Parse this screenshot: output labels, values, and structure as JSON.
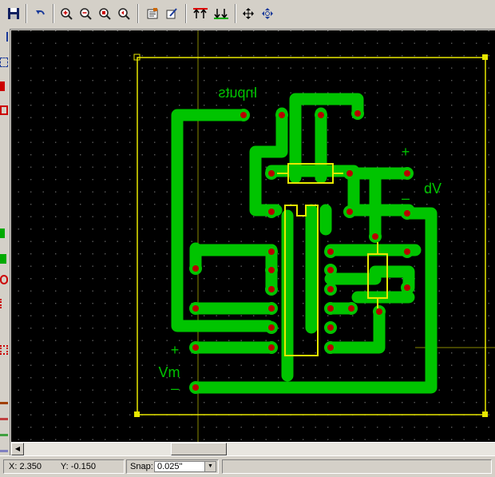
{
  "toolbar": {
    "buttons": [
      {
        "name": "save-button",
        "icon": "floppy-disk-icon"
      },
      {
        "name": "undo-button",
        "icon": "undo-arrow-icon"
      },
      {
        "name": "zoom-in-button",
        "icon": "zoom-in-icon"
      },
      {
        "name": "zoom-out-button",
        "icon": "zoom-out-icon"
      },
      {
        "name": "zoom-fit-button",
        "icon": "zoom-fit-icon"
      },
      {
        "name": "zoom-previous-button",
        "icon": "zoom-previous-icon"
      },
      {
        "name": "properties-button",
        "icon": "properties-icon"
      },
      {
        "name": "edit-button",
        "icon": "edit-icon"
      },
      {
        "name": "layer-top-button",
        "icon": "layer-top-icon"
      },
      {
        "name": "layer-bottom-button",
        "icon": "layer-bottom-icon"
      },
      {
        "name": "pan-button",
        "icon": "move-arrows-icon"
      },
      {
        "name": "move-button",
        "icon": "move-cross-icon"
      }
    ]
  },
  "board": {
    "label_inputs": "Inputs",
    "label_vb": "Vb",
    "label_vm": "Vm",
    "plus": "+",
    "minus": "–"
  },
  "status": {
    "x_label": "X:",
    "x_value": "2.350",
    "y_label": "Y:",
    "y_value": "-0.150",
    "snap_label": "Snap:",
    "snap_value": "0.025\""
  },
  "colors": {
    "canvas": "#000000",
    "trace": "#00c400",
    "pad": "#b80000",
    "silkscreen": "#e8e800",
    "grid_dot": "#5c5c5c"
  }
}
